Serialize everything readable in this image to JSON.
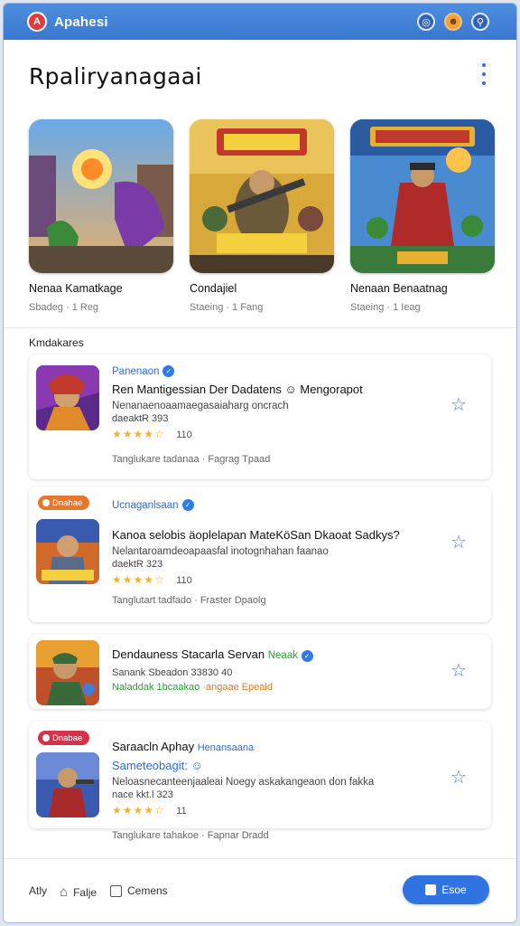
{
  "app": {
    "name": "Apahesi",
    "logo_letter": "A"
  },
  "titlebar_icons": [
    "camera-icon",
    "avatar-icon",
    "info-icon"
  ],
  "page": {
    "title": "Rpaliryanagaai"
  },
  "featured": [
    {
      "name": "Nenaa Kamatkage",
      "meta": "Sbadeg · 1 Reg"
    },
    {
      "name": "Condajiel",
      "meta": "Staeing · 1 Fang"
    },
    {
      "name": "Nenaan Benaatnag",
      "meta": "Staeing · 1 Ieag"
    }
  ],
  "section": {
    "label": "Kmdakares"
  },
  "cards": [
    {
      "publisher": "Panenaon",
      "title": "Ren Mantigessian Der Dadatens ☺ Mengorapot",
      "desc": "Nenanaenoaamaegasaiaharg oncrach",
      "stat": "daeaktR 393",
      "stars": "★★★★☆",
      "rating_count": "110",
      "footer": "Tanglukare tadanaa  ·  Fagrag Tpaad"
    },
    {
      "badge": "Dnahae",
      "publisher": "Ucnaganlsaan",
      "title": "Kanoa selobis äoplelapan MateKöSan Dkaoat Sadkys?",
      "desc": "Nelantaroamdeoapaasfal inotognhahan faanao",
      "stat": "daektR 323",
      "stars": "★★★★☆",
      "rating_count": "110",
      "footer": "Tanglutart tadfado  ·  Fraster Dpaolg"
    },
    {
      "title": "Dendauness Stacarla Servan",
      "title_tag": "Neaak",
      "stat": "Sanank Sbeadon 33830 40",
      "tags_line": "Naladdak  1bcaakao",
      "tags_line_tail": "·angaae Epeald"
    },
    {
      "badge": "Dnabae",
      "publisher": "Saraacln Aphay",
      "publisher_tag": "Henansaana",
      "title": "Sameteobagit: ☺",
      "desc": "Neloasnecanteenjaaleai Noegy askakangeaon don fakka",
      "stat": "nace kkt.l 323",
      "stars": "★★★★☆",
      "rating_count": "11",
      "footer": "Tanglukare tahakoe  ·  Fapnar Dradd"
    }
  ],
  "bottom": {
    "item1": "Atly",
    "item2": "Falje",
    "item3": "Cemens",
    "button": "Esoe"
  },
  "colors": {
    "accent": "#2f74e0",
    "titlebar": "#3a78cf",
    "star": "#f0b429",
    "tag_green": "#2f9a3a",
    "tag_orange": "#e07a1f"
  }
}
